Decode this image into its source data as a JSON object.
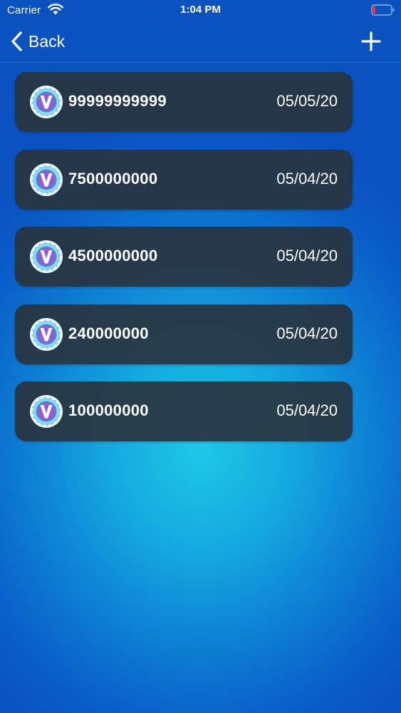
{
  "status_bar": {
    "carrier": "Carrier",
    "time": "1:04 PM"
  },
  "nav": {
    "back_label": "Back",
    "add_icon": "plus-icon"
  },
  "entries": [
    {
      "amount": "99999999999",
      "date": "05/05/20"
    },
    {
      "amount": "7500000000",
      "date": "05/04/20"
    },
    {
      "amount": "4500000000",
      "date": "05/04/20"
    },
    {
      "amount": "240000000",
      "date": "05/04/20"
    },
    {
      "amount": "100000000",
      "date": "05/04/20"
    }
  ],
  "colors": {
    "card_background": "#28343f",
    "background_center": "#1ec8e6",
    "background_edge": "#0a52bf"
  }
}
